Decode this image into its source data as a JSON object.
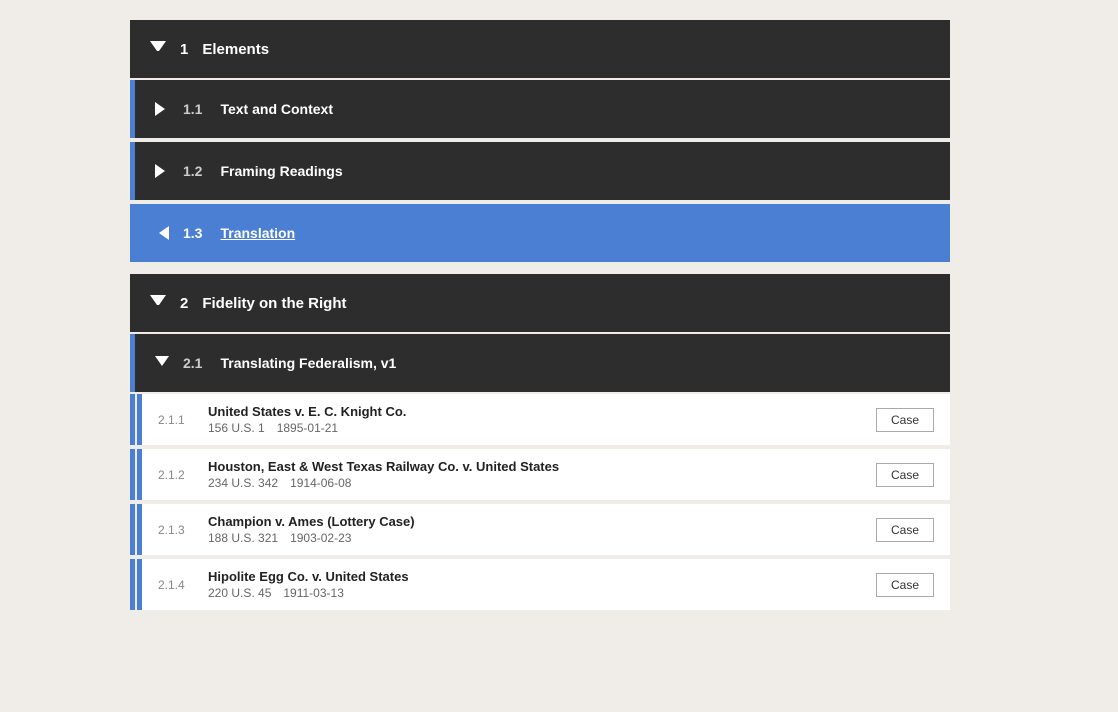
{
  "sections": [
    {
      "id": "section-1",
      "num": "1",
      "title": "Elements",
      "expanded": true,
      "subsections": [
        {
          "id": "sub-1-1",
          "num": "1.1",
          "title": "Text and Context",
          "expanded": false,
          "active": false
        },
        {
          "id": "sub-1-2",
          "num": "1.2",
          "title": "Framing Readings",
          "expanded": false,
          "active": false
        },
        {
          "id": "sub-1-3",
          "num": "1.3",
          "title": "Translation",
          "expanded": false,
          "active": true
        }
      ]
    },
    {
      "id": "section-2",
      "num": "2",
      "title": "Fidelity on the Right",
      "expanded": true,
      "subsections": [
        {
          "id": "sub-2-1",
          "num": "2.1",
          "title": "Translating Federalism, v1",
          "expanded": true,
          "active": false,
          "cases": [
            {
              "id": "case-2-1-1",
              "num": "2.1.1",
              "title": "United States v. E. C. Knight Co.",
              "citation": "156 U.S. 1",
              "date": "1895-01-21",
              "button_label": "Case"
            },
            {
              "id": "case-2-1-2",
              "num": "2.1.2",
              "title": "Houston, East & West Texas Railway Co. v. United States",
              "citation": "234 U.S. 342",
              "date": "1914-06-08",
              "button_label": "Case"
            },
            {
              "id": "case-2-1-3",
              "num": "2.1.3",
              "title": "Champion v. Ames (Lottery Case)",
              "citation": "188 U.S. 321",
              "date": "1903-02-23",
              "button_label": "Case"
            },
            {
              "id": "case-2-1-4",
              "num": "2.1.4",
              "title": "Hipolite Egg Co. v. United States",
              "citation": "220 U.S. 45",
              "date": "1911-03-13",
              "button_label": "Case"
            }
          ]
        }
      ]
    }
  ]
}
